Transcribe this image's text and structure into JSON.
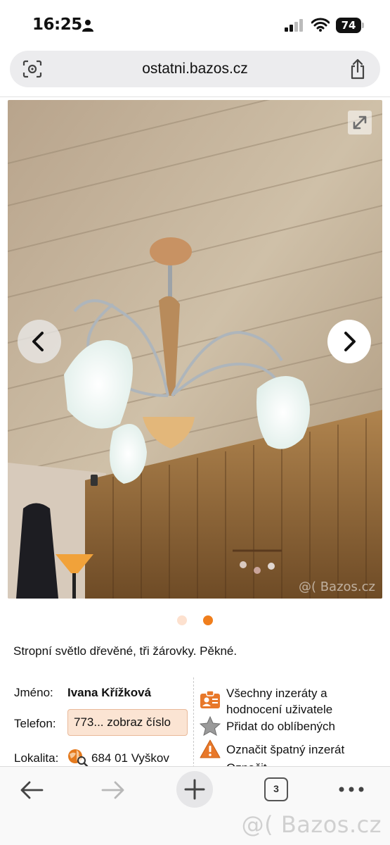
{
  "status_bar": {
    "time": "16:25",
    "battery": "74",
    "icons": [
      "person-icon",
      "signal-icon",
      "wifi-icon",
      "battery-icon"
    ]
  },
  "address_bar": {
    "url": "ostatni.bazos.cz",
    "left_icon": "lens-icon",
    "right_icon": "share-icon"
  },
  "gallery": {
    "watermark": "@( Bazos.cz",
    "slide_count": 2,
    "active_slide": 2,
    "icons": [
      "expand-icon",
      "chevron-left-icon",
      "chevron-right-icon"
    ]
  },
  "ad": {
    "description": "Stropní světlo dřevěné, tři žárovky. Pěkné."
  },
  "seller": {
    "name_label": "Jméno:",
    "name": "Ivana Křížková",
    "phone_label": "Telefon:",
    "phone_button": "773... zobraz číslo",
    "location_label": "Lokalita:",
    "location": "684 01 Vyškov"
  },
  "actions": {
    "all_ads_line1": "Všechny inzeráty a",
    "all_ads_line2": "hodnocení uživatele",
    "favorite": "Přidat do oblíbených",
    "report": "Označit špatný inzerát",
    "cut_off": "Označit...",
    "colors": {
      "accent": "#f07e1c",
      "phone_bg": "#fbe4d3"
    }
  },
  "toolbar": {
    "tabs_count": "3",
    "icons": [
      "back-arrow-icon",
      "forward-arrow-icon",
      "plus-icon",
      "tabs-icon",
      "more-icon"
    ],
    "watermark": "@( Bazos.cz"
  }
}
